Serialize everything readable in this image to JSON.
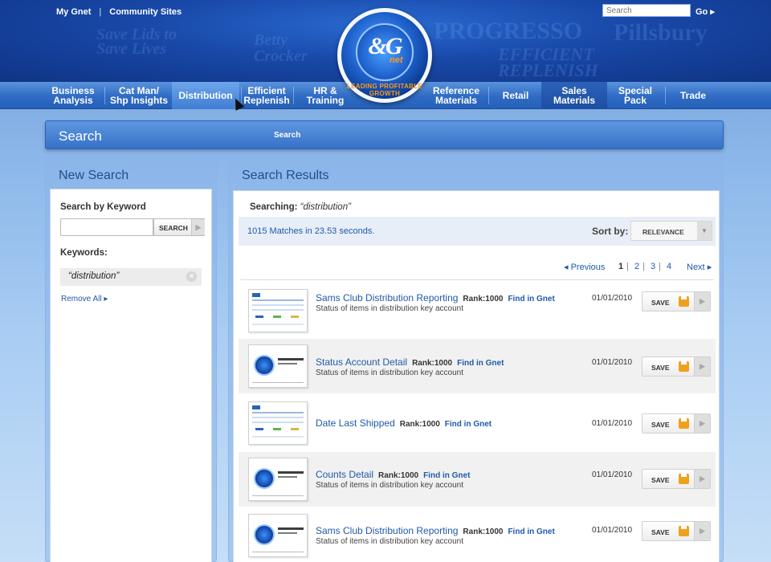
{
  "header": {
    "top_links": [
      "My Gnet",
      "Community Sites"
    ],
    "top_separator": "|",
    "search_placeholder": "Search",
    "go_label": "Go",
    "logo": {
      "mark": "&G",
      "sub": "net",
      "slogan": "LEADING PROFITABLE GROWTH"
    },
    "background_brands": [
      "Betty Crocker",
      "PROGRESSO",
      "Pillsbury",
      "Save Lids to Save Lives",
      "EFFICIENT REPLENISH"
    ]
  },
  "nav": {
    "items": [
      {
        "line1": "Business",
        "line2": "Analysis"
      },
      {
        "line1": "Cat Man/",
        "line2": "Shp Insights"
      },
      {
        "line1": "Distribution",
        "line2": ""
      },
      {
        "line1": "Efficient",
        "line2": "Replenish"
      },
      {
        "line1": "HR &",
        "line2": "Training"
      },
      {
        "line1": "Reference",
        "line2": "Materials"
      },
      {
        "line1": "Retail",
        "line2": ""
      },
      {
        "line1": "Sales",
        "line2": "Materials"
      },
      {
        "line1": "Special",
        "line2": "Pack"
      },
      {
        "line1": "Trade",
        "line2": ""
      }
    ]
  },
  "search_bar": {
    "title": "Search",
    "right_label": "Search"
  },
  "new_search": {
    "title": "New Search",
    "keyword_label": "Search by Keyword",
    "search_button": "SEARCH",
    "keywords_label": "Keywords:",
    "keyword_chip": "“distribution”",
    "remove_all": "Remove All"
  },
  "results": {
    "title": "Search Results",
    "searching_label": "Searching:",
    "searching_term": "“distribution”",
    "matches_text": "1015 Matches in 23.53 seconds.",
    "sort_label": "Sort by:",
    "sort_value": "RELEVANCE",
    "pager": {
      "previous": "Previous",
      "pages": [
        "1",
        "2",
        "3",
        "4"
      ],
      "current": "1",
      "next": "Next"
    },
    "items": [
      {
        "title": "Sams Club Distribution Reporting",
        "rank": "Rank:1000",
        "find": "Find in Gnet",
        "desc": "Status of items in distribution key account",
        "date": "01/01/2010",
        "save": "SAVE",
        "thumb": "sheet"
      },
      {
        "title": "Status Account Detail",
        "rank": "Rank:1000",
        "find": "Find in Gnet",
        "desc": "Status of items in distribution key account",
        "date": "01/01/2010",
        "save": "SAVE",
        "thumb": "logo"
      },
      {
        "title": "Date Last Shipped",
        "rank": "Rank:1000",
        "find": "Find in Gnet",
        "desc": "",
        "date": "01/01/2010",
        "save": "SAVE",
        "thumb": "sheet"
      },
      {
        "title": "Counts Detail",
        "rank": "Rank:1000",
        "find": "Find in Gnet",
        "desc": "Status of items in distribution key account",
        "date": "01/01/2010",
        "save": "SAVE",
        "thumb": "logo"
      },
      {
        "title": "Sams Club Distribution Reporting",
        "rank": "Rank:1000",
        "find": "Find in Gnet",
        "desc": "Status of items in distribution key account",
        "date": "01/01/2010",
        "save": "SAVE",
        "thumb": "logo"
      }
    ]
  },
  "colors": {
    "brand_blue": "#1848a8",
    "link": "#1f5aa8",
    "accent_orange": "#f0a11c"
  }
}
